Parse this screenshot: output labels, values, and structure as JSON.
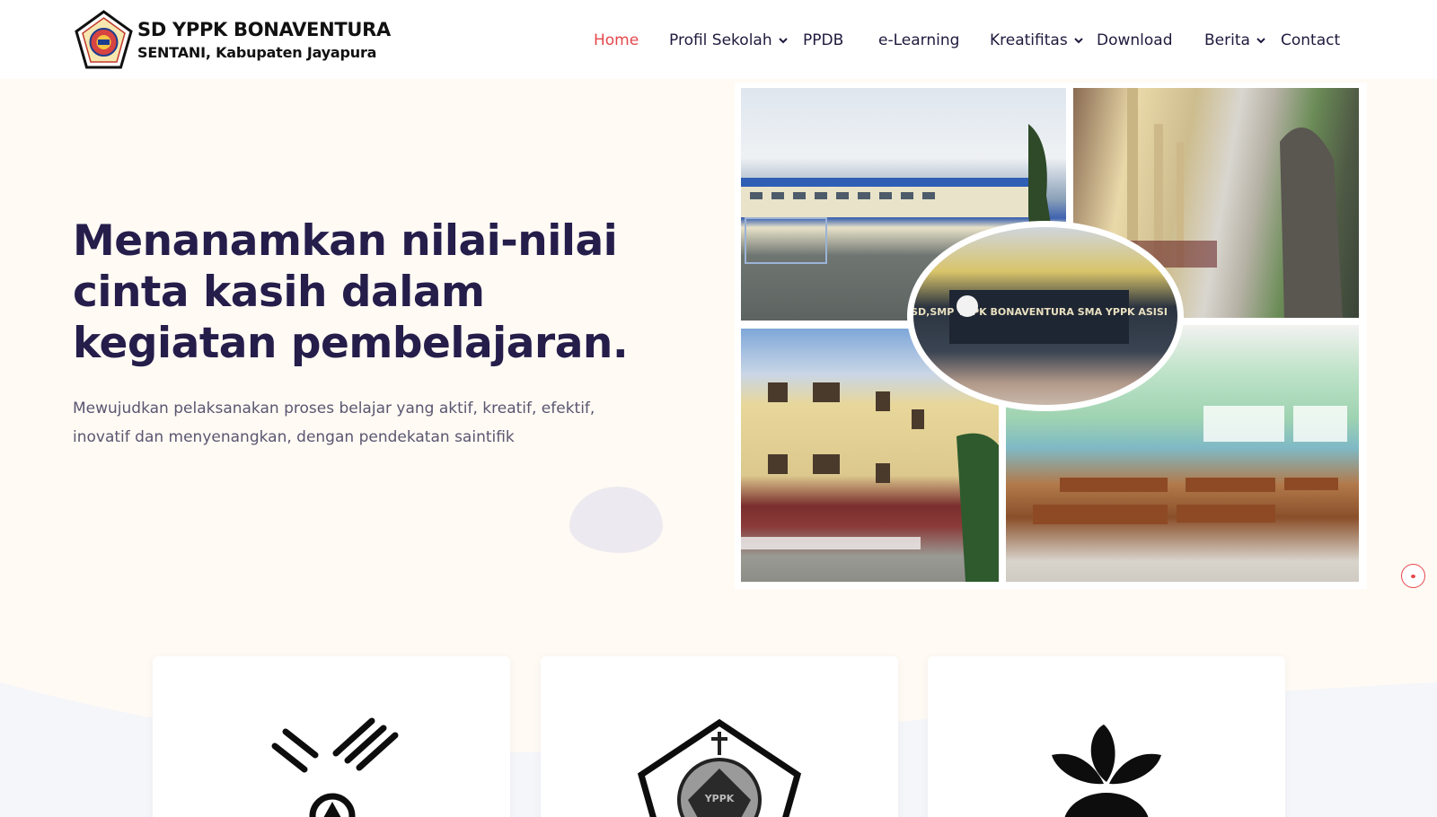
{
  "header": {
    "brand_title": "SD YPPK BONAVENTURA",
    "brand_subtitle": "SENTANI, Kabupaten Jayapura",
    "logo_icon": "school-crest-icon"
  },
  "nav": {
    "items": [
      {
        "label": "Home",
        "active": true,
        "dropdown": false
      },
      {
        "label": "Profil Sekolah",
        "active": false,
        "dropdown": true
      },
      {
        "label": "PPDB",
        "active": false,
        "dropdown": false
      },
      {
        "label": "e-Learning",
        "active": false,
        "dropdown": false
      },
      {
        "label": "Kreatifitas",
        "active": false,
        "dropdown": true
      },
      {
        "label": "Download",
        "active": false,
        "dropdown": false
      },
      {
        "label": "Berita",
        "active": false,
        "dropdown": true
      },
      {
        "label": "Contact",
        "active": false,
        "dropdown": false
      }
    ],
    "active_color": "#e5474b"
  },
  "hero": {
    "headline": "Menanamkan nilai-nilai cinta kasih dalam kegiatan pembelajaran.",
    "subtext": "Mewujudkan pelaksanakan proses belajar yang aktif, kreatif, efektif, inovatif dan menyenangkan, dengan pendekatan saintifik",
    "sign_text": "SD,SMP YPPK BONAVENTURA SMA YPPK ASISI"
  },
  "cards": [
    {
      "icon": "medal-icon"
    },
    {
      "icon": "yppk-emblem-icon"
    },
    {
      "icon": "sprout-icon"
    }
  ],
  "colors": {
    "accent": "#e5474b",
    "heading": "#251d4a",
    "hero_bg": "#fffaf4"
  }
}
